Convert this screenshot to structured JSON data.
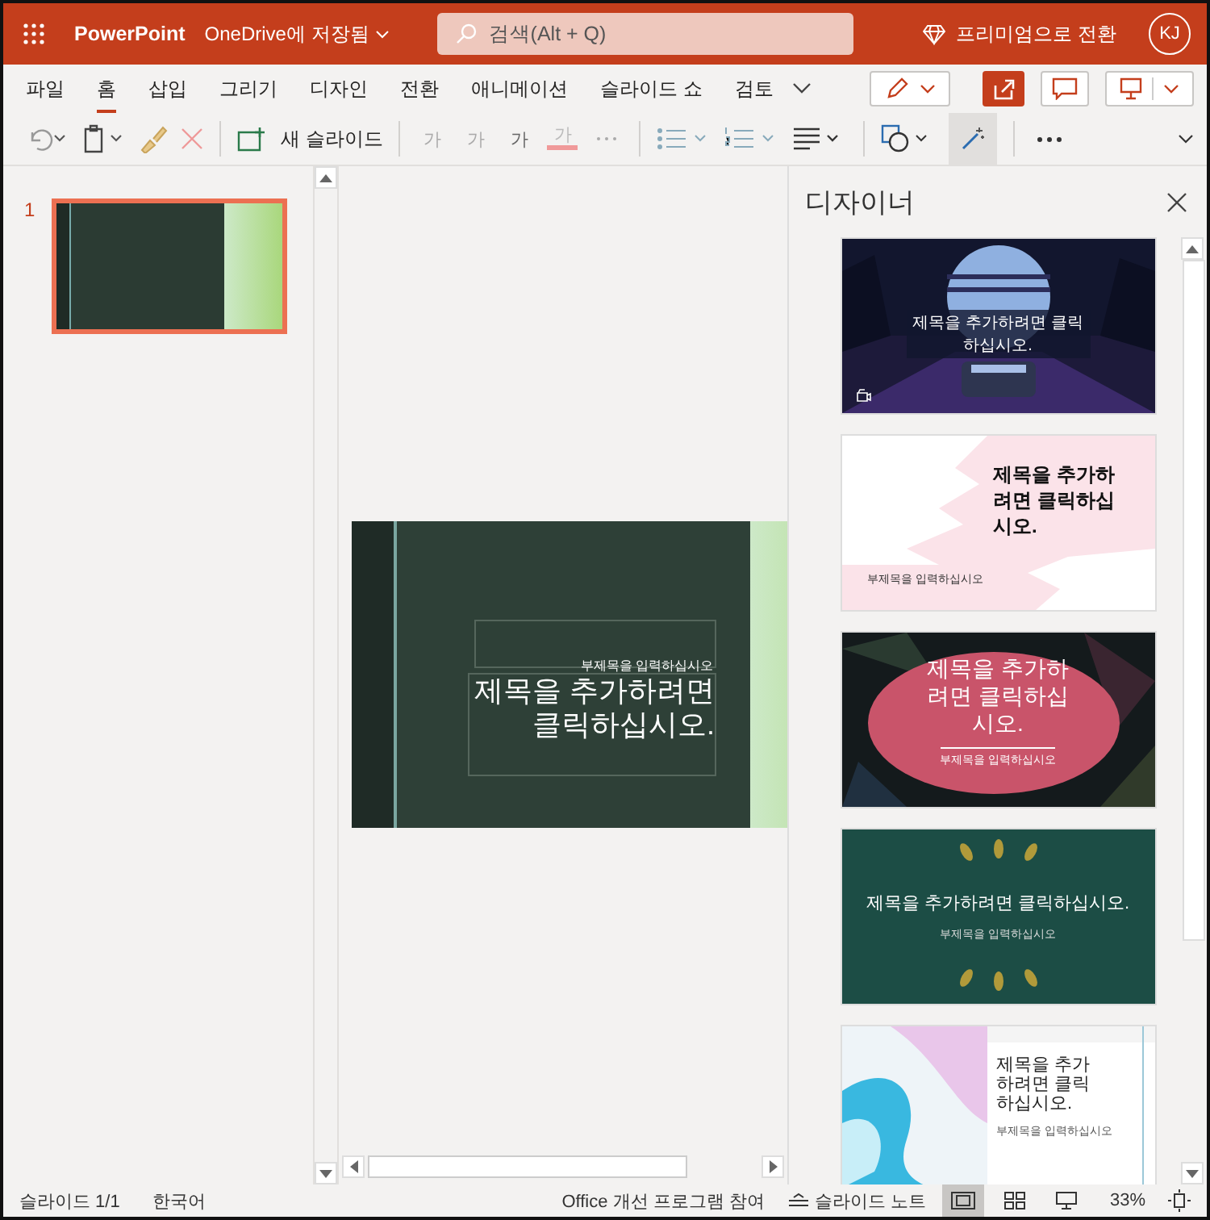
{
  "titlebar": {
    "app": "PowerPoint",
    "file_status": "OneDrive에 저장됨",
    "search": {
      "placeholder": "검색(Alt + Q)"
    },
    "premium": "프리미엄으로 전환",
    "avatar": "KJ"
  },
  "tabs": [
    {
      "label": "파일",
      "selected": false
    },
    {
      "label": "홈",
      "selected": true
    },
    {
      "label": "삽입",
      "selected": false
    },
    {
      "label": "그리기",
      "selected": false
    },
    {
      "label": "디자인",
      "selected": false
    },
    {
      "label": "전환",
      "selected": false
    },
    {
      "label": "애니메이션",
      "selected": false
    },
    {
      "label": "슬라이드 쇼",
      "selected": false
    },
    {
      "label": "검토",
      "selected": false
    }
  ],
  "toolbar": {
    "new_slide": "새 슬라이드",
    "font_buttons": [
      {
        "label": "가",
        "kind": "grow"
      },
      {
        "label": "가",
        "kind": "shrink"
      },
      {
        "label": "가",
        "kind": "plain"
      },
      {
        "label": "가",
        "kind": "color"
      }
    ]
  },
  "thumbnails": [
    {
      "number": "1",
      "selected": true
    }
  ],
  "slide": {
    "subtitle": "부제목을 입력하십시오",
    "title": "제목을 추가하려면 클릭하십시오."
  },
  "designer": {
    "title": "디자이너",
    "designs": [
      {
        "kind": "synthwave",
        "title": "제목을 추가하려면 클릭하십시오."
      },
      {
        "kind": "pink",
        "title": "제목을 추가하려면 클릭하십시오.",
        "subtitle": "부제목을 입력하십시오"
      },
      {
        "kind": "red",
        "title": "제목을 추가하려면 클릭하십시오.",
        "subtitle": "부제목을 입력하십시오"
      },
      {
        "kind": "green",
        "title": "제목을 추가하려면 클릭하십시오.",
        "subtitle": "부제목을 입력하십시오"
      },
      {
        "kind": "marble",
        "title": "제목을 추가하려면 클릭하십시오.",
        "subtitle": "부제목을 입력하십시오"
      }
    ]
  },
  "status_bar": {
    "slide_count": "슬라이드 1/1",
    "language": "한국어",
    "feedback": "Office 개선 프로그램 참여",
    "notes": "슬라이드 노트",
    "views": [
      {
        "kind": "normal",
        "selected": true
      },
      {
        "kind": "sorter",
        "selected": false
      },
      {
        "kind": "reading",
        "selected": false
      }
    ],
    "zoom": "33%"
  }
}
